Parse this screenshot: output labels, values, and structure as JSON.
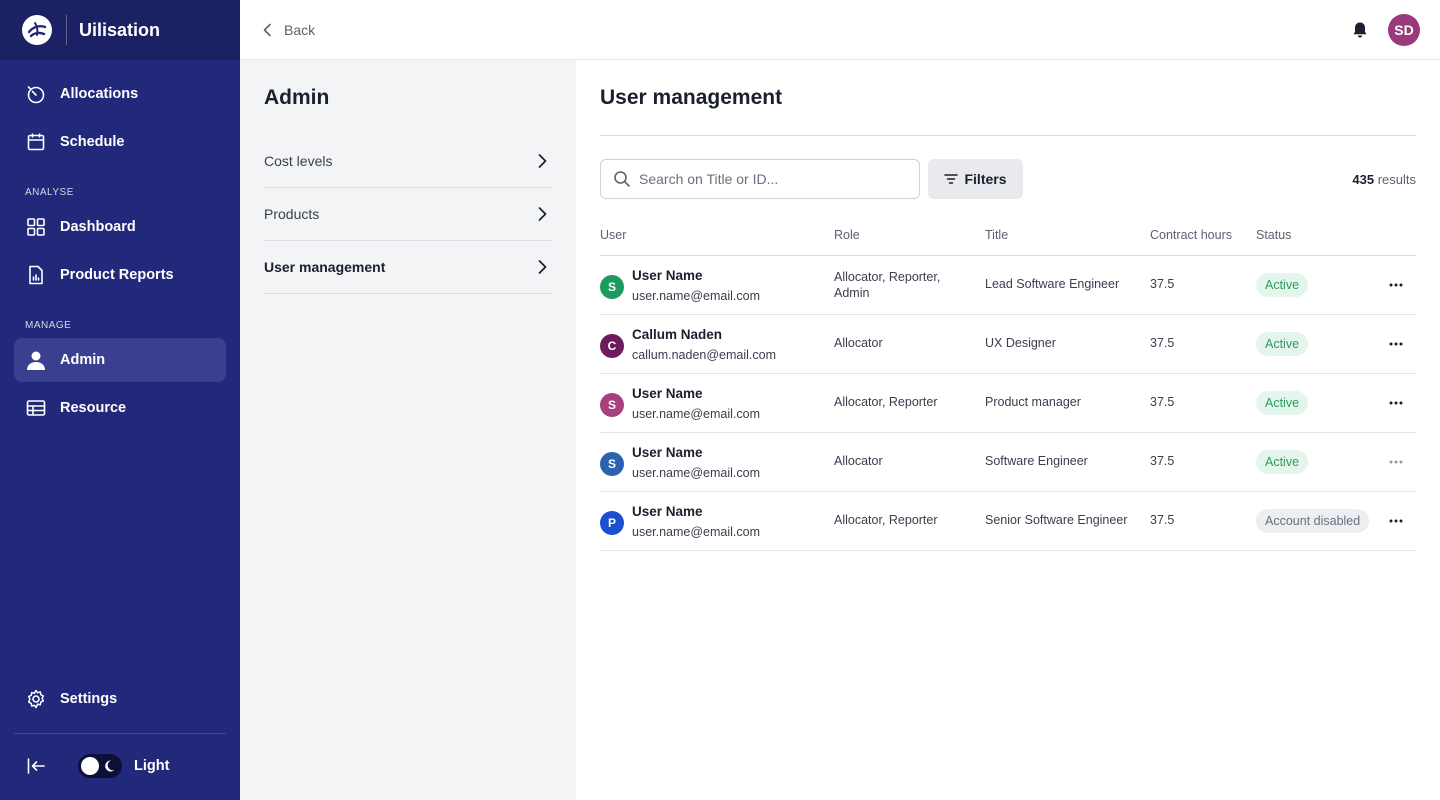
{
  "brand": {
    "name": "Uilisation"
  },
  "sidebar": {
    "items_top": [
      {
        "label": "Allocations",
        "icon": "timer-icon"
      },
      {
        "label": "Schedule",
        "icon": "calendar-icon"
      }
    ],
    "section_analyse": "ANALYSE",
    "items_analyse": [
      {
        "label": "Dashboard",
        "icon": "grid-icon"
      },
      {
        "label": "Product Reports",
        "icon": "report-icon"
      }
    ],
    "section_manage": "MANAGE",
    "items_manage": [
      {
        "label": "Admin",
        "icon": "user-icon",
        "active": true
      },
      {
        "label": "Resource",
        "icon": "table-icon"
      }
    ],
    "settings_label": "Settings",
    "theme_label": "Light"
  },
  "topbar": {
    "back_label": "Back",
    "avatar_initials": "SD"
  },
  "admin": {
    "title": "Admin",
    "items": [
      {
        "label": "Cost levels"
      },
      {
        "label": "Products"
      },
      {
        "label": "User management",
        "active": true
      }
    ]
  },
  "main": {
    "title": "User management",
    "search_placeholder": "Search on Title or ID...",
    "filters_label": "Filters",
    "results_count": "435",
    "results_label": "results",
    "columns": [
      "User",
      "Role",
      "Title",
      "Contract hours",
      "Status"
    ],
    "rows": [
      {
        "initial": "S",
        "color": "#1e9a5e",
        "name": "User Name",
        "email": "user.name@email.com",
        "role": "Allocator, Reporter, Admin",
        "title": "Lead Software Engineer",
        "hours": "37.5",
        "status": "Active",
        "status_type": "active"
      },
      {
        "initial": "C",
        "color": "#6e1a5e",
        "name": "Callum Naden",
        "email": "callum.naden@email.com",
        "role": "Allocator",
        "title": "UX Designer",
        "hours": "37.5",
        "status": "Active",
        "status_type": "active"
      },
      {
        "initial": "S",
        "color": "#a8407e",
        "name": "User Name",
        "email": "user.name@email.com",
        "role": "Allocator, Reporter",
        "title": "Product manager",
        "hours": "37.5",
        "status": "Active",
        "status_type": "active"
      },
      {
        "initial": "S",
        "color": "#2a62ad",
        "name": "User Name",
        "email": "user.name@email.com",
        "role": "Allocator",
        "title": "Software Engineer",
        "hours": "37.5",
        "status": "Active",
        "status_type": "active"
      },
      {
        "initial": "P",
        "color": "#1b4fd0",
        "name": "User Name",
        "email": "user.name@email.com",
        "role": "Allocator, Reporter",
        "title": "Senior Software Engineer",
        "hours": "37.5",
        "status": "Account disabled",
        "status_type": "disabled"
      }
    ]
  },
  "colors": {
    "sidebar_bg": "#23297a",
    "brand_bg": "#1b2163",
    "active_status_bg": "#e4f5ec",
    "active_status_text": "#2f9a62"
  }
}
